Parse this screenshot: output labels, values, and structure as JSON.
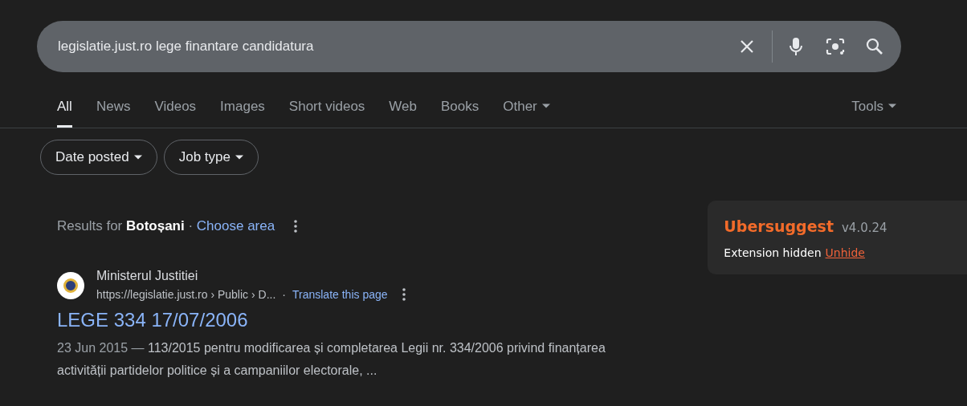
{
  "search": {
    "value": "legislatie.just.ro lege finantare candidatura"
  },
  "tabs": [
    {
      "label": "All",
      "selected": true,
      "dropdown": false
    },
    {
      "label": "News",
      "selected": false,
      "dropdown": false
    },
    {
      "label": "Videos",
      "selected": false,
      "dropdown": false
    },
    {
      "label": "Images",
      "selected": false,
      "dropdown": false
    },
    {
      "label": "Short videos",
      "selected": false,
      "dropdown": false
    },
    {
      "label": "Web",
      "selected": false,
      "dropdown": false
    },
    {
      "label": "Books",
      "selected": false,
      "dropdown": false
    },
    {
      "label": "Other",
      "selected": false,
      "dropdown": true
    }
  ],
  "tools": {
    "label": "Tools"
  },
  "filters": [
    {
      "label": "Date posted"
    },
    {
      "label": "Job type"
    }
  ],
  "location": {
    "text": "Results for **Botoșani** · ",
    "link": "Choose area"
  },
  "result": {
    "site": "Ministerul Justitiei",
    "url": "https://legislatie.just.ro › Public › D...",
    "separator": "·",
    "translate": "Translate this page",
    "title": "LEGE 334 17/07/2006",
    "date": "23 Jun 2015 — ",
    "snippet": "113/2015 pentru modificarea și completarea Legii nr. 334/2006 privind finanțarea activității partidelor politice și a campaniilor electorale, ..."
  },
  "extension": {
    "name": "Ubersuggest",
    "version": "v4.0.24",
    "status": "Extension hidden",
    "action": "Unhide"
  }
}
